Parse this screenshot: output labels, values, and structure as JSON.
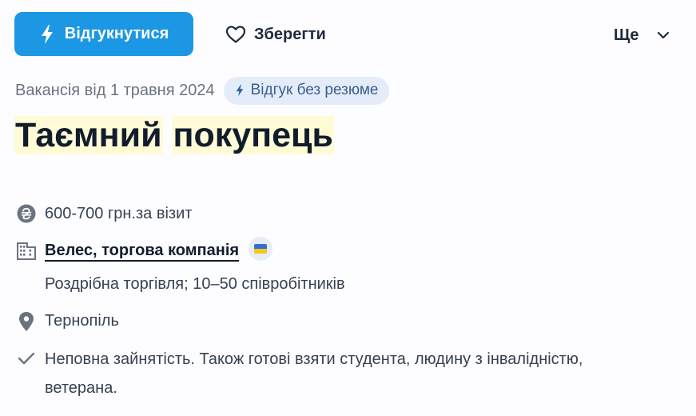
{
  "toolbar": {
    "apply_label": "Відгукнутися",
    "save_label": "Зберегти",
    "more_label": "Ще"
  },
  "vacancy": {
    "date_text": "Вакансія від 1 травня 2024",
    "badge_text": "Відгук без резюме",
    "title_words": [
      "Таємний",
      "покупець"
    ]
  },
  "details": {
    "salary": "600-700 грн.за візит",
    "company_name": "Велес, торгова компанія",
    "company_info": "Роздрібна торгівля; 10–50 співробітників",
    "city": "Тернопіль",
    "employment_line1": "Неповна зайнятість. Також готові взяти студента, людину з інвалідністю,",
    "employment_line2": "ветерана."
  },
  "colors": {
    "accent": "#1c97e3",
    "title_highlight": "#fffbd6",
    "badge_bg": "#e3ecf8",
    "icon_gray": "#6b7280"
  },
  "icons": [
    "lightning-icon",
    "heart-icon",
    "chevron-down-icon",
    "hryvnia-icon",
    "building-icon",
    "ukraine-flag-icon",
    "location-pin-icon",
    "checkmark-icon"
  ]
}
